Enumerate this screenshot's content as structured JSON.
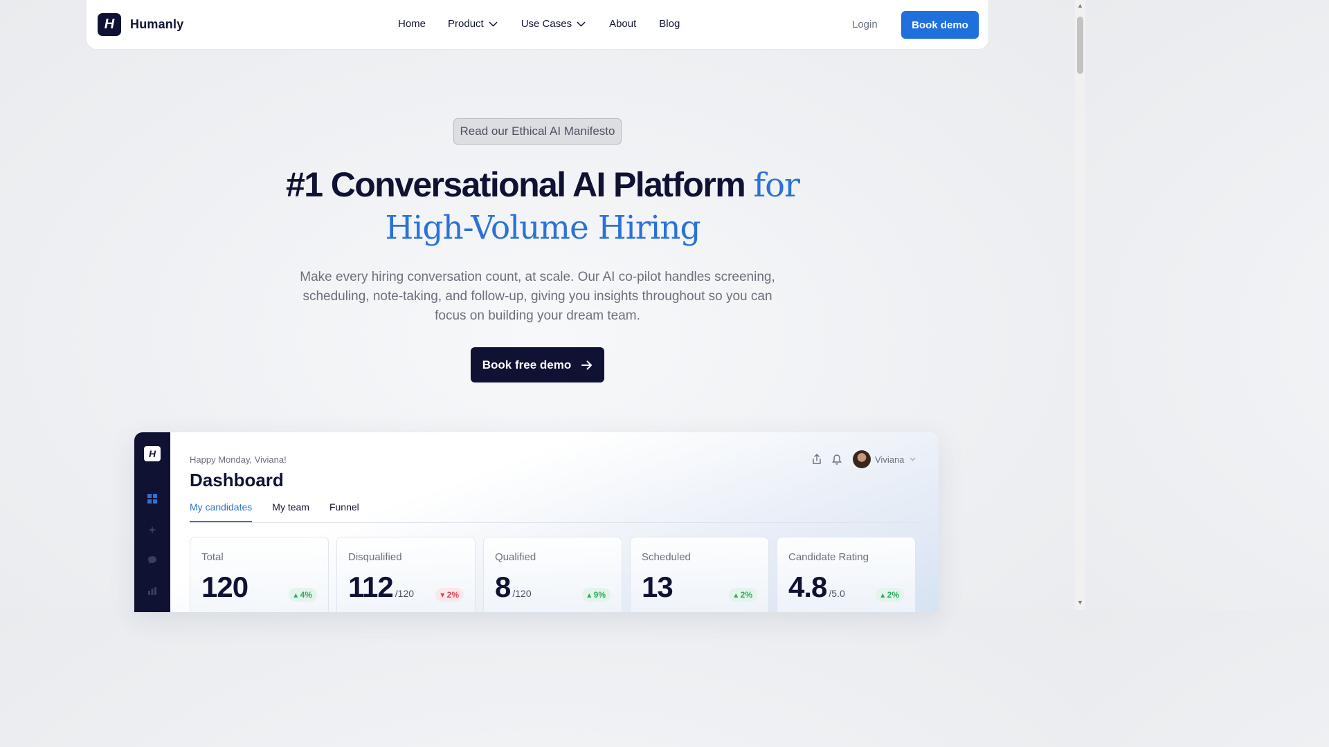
{
  "nav": {
    "brand": "Humanly",
    "logo_letter": "H",
    "links": [
      {
        "label": "Home"
      },
      {
        "label": "Product"
      },
      {
        "label": "Use Cases"
      },
      {
        "label": "About"
      },
      {
        "label": "Blog"
      }
    ],
    "login": "Login",
    "book_demo": "Book demo"
  },
  "hero": {
    "manifesto_link": "Read our Ethical AI Manifesto",
    "headline_main": "#1 Conversational AI Platform ",
    "headline_accent": "for",
    "headline_line2": "High-Volume Hiring",
    "subtext": "Make every hiring conversation count, at scale. Our AI co-pilot handles screening, scheduling, note-taking, and follow-up, giving you insights throughout so you can focus on building your dream team.",
    "cta": "Book free demo"
  },
  "dashboard": {
    "logo_letter": "H",
    "greeting": "Happy Monday, Viviana!",
    "title": "Dashboard",
    "tabs": [
      {
        "label": "My candidates",
        "active": true
      },
      {
        "label": "My team",
        "active": false
      },
      {
        "label": "Funnel",
        "active": false
      }
    ],
    "user": "Viviana",
    "cards": [
      {
        "label": "Total",
        "value": "120",
        "of": "",
        "delta": "4%",
        "direction": "up"
      },
      {
        "label": "Disqualified",
        "value": "112",
        "of": "/120",
        "delta": "2%",
        "direction": "down"
      },
      {
        "label": "Qualified",
        "value": "8",
        "of": "/120",
        "delta": "9%",
        "direction": "up"
      },
      {
        "label": "Scheduled",
        "value": "13",
        "of": "",
        "delta": "2%",
        "direction": "up"
      },
      {
        "label": "Candidate Rating",
        "value": "4.8",
        "of": "/5.0",
        "delta": "2%",
        "direction": "up"
      }
    ]
  },
  "colors": {
    "navy": "#0f1233",
    "accent_blue": "#2a72d6",
    "button_blue": "#1f6fdc",
    "positive": "#2eaa62",
    "negative": "#d64555"
  }
}
